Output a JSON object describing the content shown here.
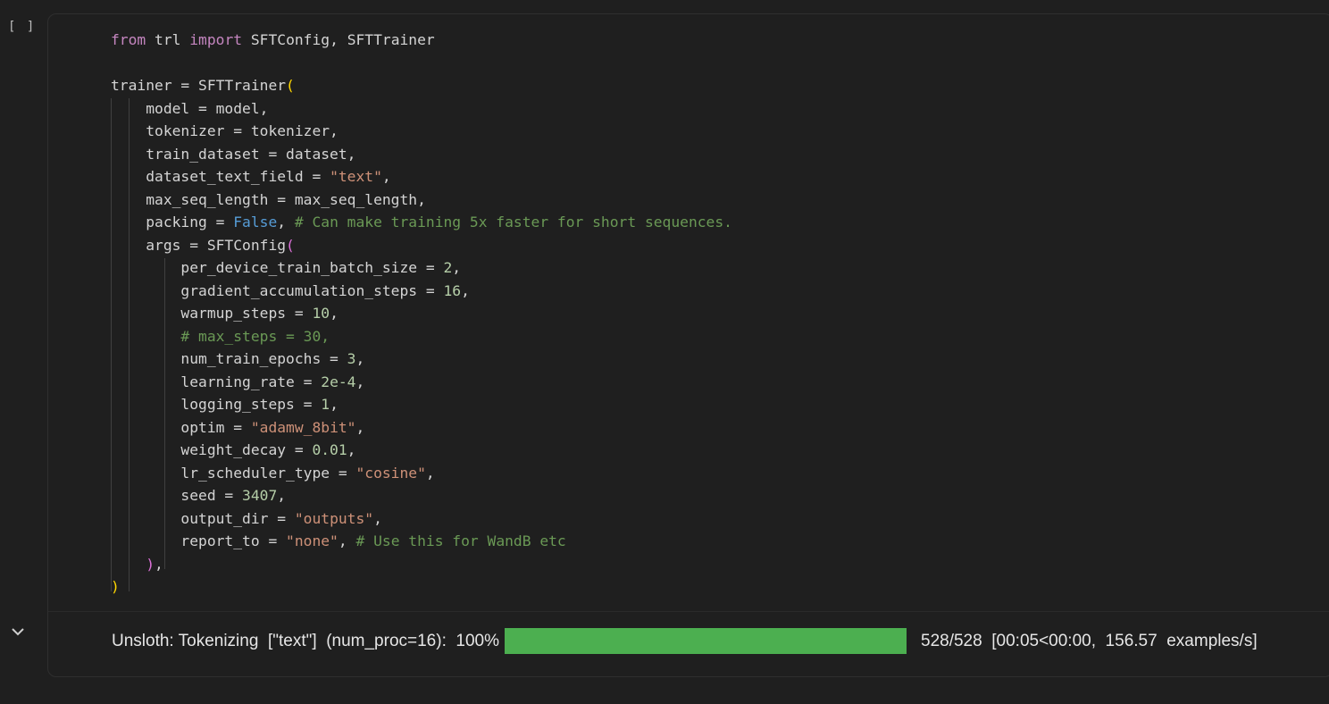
{
  "cell": {
    "run_indicator": "[ ]",
    "code_lines": [
      [
        [
          "from",
          "kw"
        ],
        [
          " trl ",
          ""
        ],
        [
          "import",
          "kw"
        ],
        [
          " SFTConfig, SFTTrainer",
          ""
        ]
      ],
      [],
      [
        [
          "trainer = SFTTrainer",
          ""
        ],
        [
          "(",
          "br1"
        ]
      ],
      [
        [
          "    model = model,",
          ""
        ]
      ],
      [
        [
          "    tokenizer = tokenizer,",
          ""
        ]
      ],
      [
        [
          "    train_dataset = dataset,",
          ""
        ]
      ],
      [
        [
          "    dataset_text_field = ",
          ""
        ],
        [
          "\"text\"",
          "str"
        ],
        [
          ",",
          ""
        ]
      ],
      [
        [
          "    max_seq_length = max_seq_length,",
          ""
        ]
      ],
      [
        [
          "    packing = ",
          ""
        ],
        [
          "False",
          "const"
        ],
        [
          ", ",
          ""
        ],
        [
          "# Can make training 5x faster for short sequences.",
          "cmt"
        ]
      ],
      [
        [
          "    args = SFTConfig",
          ""
        ],
        [
          "(",
          "br2"
        ]
      ],
      [
        [
          "        per_device_train_batch_size = ",
          ""
        ],
        [
          "2",
          "num"
        ],
        [
          ",",
          ""
        ]
      ],
      [
        [
          "        gradient_accumulation_steps = ",
          ""
        ],
        [
          "16",
          "num"
        ],
        [
          ",",
          ""
        ]
      ],
      [
        [
          "        warmup_steps = ",
          ""
        ],
        [
          "10",
          "num"
        ],
        [
          ",",
          ""
        ]
      ],
      [
        [
          "        ",
          ""
        ],
        [
          "# max_steps = 30,",
          "cmt"
        ]
      ],
      [
        [
          "        num_train_epochs = ",
          ""
        ],
        [
          "3",
          "num"
        ],
        [
          ",",
          ""
        ]
      ],
      [
        [
          "        learning_rate = ",
          ""
        ],
        [
          "2e-4",
          "num"
        ],
        [
          ",",
          ""
        ]
      ],
      [
        [
          "        logging_steps = ",
          ""
        ],
        [
          "1",
          "num"
        ],
        [
          ",",
          ""
        ]
      ],
      [
        [
          "        optim = ",
          ""
        ],
        [
          "\"adamw_8bit\"",
          "str"
        ],
        [
          ",",
          ""
        ]
      ],
      [
        [
          "        weight_decay = ",
          ""
        ],
        [
          "0.01",
          "num"
        ],
        [
          ",",
          ""
        ]
      ],
      [
        [
          "        lr_scheduler_type = ",
          ""
        ],
        [
          "\"cosine\"",
          "str"
        ],
        [
          ",",
          ""
        ]
      ],
      [
        [
          "        seed = ",
          ""
        ],
        [
          "3407",
          "num"
        ],
        [
          ",",
          ""
        ]
      ],
      [
        [
          "        output_dir = ",
          ""
        ],
        [
          "\"outputs\"",
          "str"
        ],
        [
          ",",
          ""
        ]
      ],
      [
        [
          "        report_to = ",
          ""
        ],
        [
          "\"none\"",
          "str"
        ],
        [
          ", ",
          ""
        ],
        [
          "# Use this for WandB etc",
          "cmt"
        ]
      ],
      [
        [
          "    ",
          ""
        ],
        [
          ")",
          "br2"
        ],
        [
          ",",
          ""
        ]
      ],
      [
        [
          ")",
          "br1"
        ]
      ]
    ]
  },
  "output": {
    "label": "Unsloth: Tokenizing  [\"text\"]  (num_proc=16):  100%",
    "progress_fraction": 1.0,
    "progress_color": "#4caf50",
    "stats": "528/528  [00:05<00:00,  156.57  examples/s]"
  },
  "icons": {
    "collapse": "chevron-down-icon"
  }
}
